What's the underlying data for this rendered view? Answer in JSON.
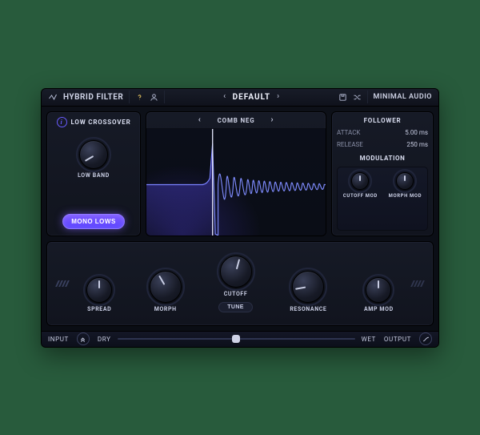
{
  "titlebar": {
    "app_name": "HYBRID FILTER",
    "preset": "DEFAULT",
    "brand": "MINIMAL AUDIO"
  },
  "left": {
    "title": "LOW CROSSOVER",
    "knob_label": "LOW BAND",
    "mono_label": "MONO LOWS"
  },
  "viz": {
    "filter_type": "COMB NEG"
  },
  "follower": {
    "title": "FOLLOWER",
    "attack_label": "ATTACK",
    "attack_value": "5.00 ms",
    "release_label": "RELEASE",
    "release_value": "250 ms",
    "mod_title": "MODULATION",
    "cutoff_mod_label": "CUTOFF MOD",
    "morph_mod_label": "MORPH MOD"
  },
  "knobs": {
    "spread": "SPREAD",
    "morph": "MORPH",
    "cutoff": "CUTOFF",
    "resonance": "RESONANCE",
    "amp_mod": "AMP MOD",
    "tune": "TUNE"
  },
  "footer": {
    "input_label": "INPUT",
    "dry_label": "DRY",
    "wet_label": "WET",
    "output_label": "OUTPUT",
    "mix_value": 50
  }
}
